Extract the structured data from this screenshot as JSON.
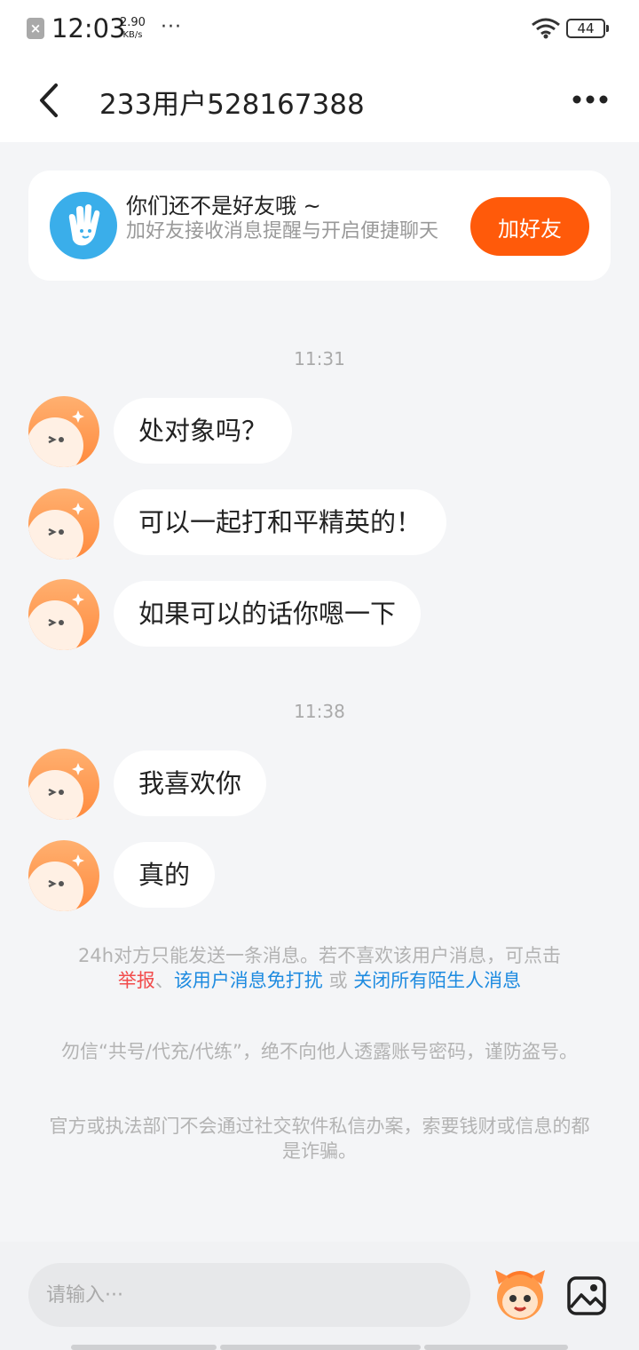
{
  "status_bar": {
    "time": "12:03",
    "speed_value": "2.90",
    "speed_unit": "KB/s",
    "more": "···",
    "battery": "44"
  },
  "header": {
    "title": "233用户528167388"
  },
  "friend_card": {
    "title": "你们还不是好友哦 ~",
    "subtitle": "加好友接收消息提醒与开启便捷聊天",
    "add_button": "加好友"
  },
  "conversation": [
    {
      "time": "11:31",
      "messages": [
        "处对象吗？",
        "可以一起打和平精英的！",
        "如果可以的话你嗯一下"
      ]
    },
    {
      "time": "11:38",
      "messages": [
        "我喜欢你",
        "真的"
      ]
    }
  ],
  "notices": {
    "limit_text": "24h对方只能发送一条消息。若不喜欢该用户消息，可点击",
    "report_link": "举报",
    "separator": "、",
    "mute_link": "该用户消息免打扰",
    "or_text": "或",
    "close_link": "关闭所有陌生人消息",
    "warning_1": "勿信“共号/代充/代练”，绝不向他人透露账号密码，谨防盗号。",
    "warning_2": "官方或执法部门不会通过社交软件私信办案，索要钱财或信息的都是诈骗。"
  },
  "input": {
    "placeholder": "请输入···"
  },
  "icons": {
    "back": "back-arrow-icon",
    "more": "more-icon",
    "hand": "hand-icon",
    "emoji": "emoji-icon",
    "image": "image-icon"
  },
  "colors": {
    "accent": "#ff5a0a",
    "link_blue": "#1e8be0",
    "link_red": "#f24b4b",
    "background": "#f4f5f7"
  }
}
